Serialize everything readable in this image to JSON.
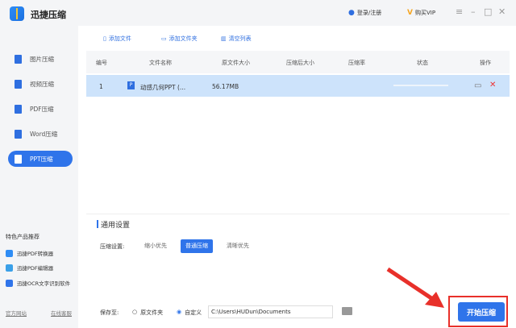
{
  "app": {
    "title": "迅捷压缩",
    "login": "登录/注册",
    "vip": "购买VIP"
  },
  "sidebar": {
    "items": [
      {
        "label": "图片压缩"
      },
      {
        "label": "视频压缩"
      },
      {
        "label": "PDF压缩"
      },
      {
        "label": "Word压缩"
      },
      {
        "label": "PPT压缩"
      }
    ],
    "promo_title": "特色产品推荐",
    "promos": [
      "迅捷PDF转换器",
      "迅捷PDF编辑器",
      "迅捷OCR文字识别软件"
    ],
    "links": [
      "官方网站",
      "在线客服"
    ]
  },
  "toolbar": {
    "add_file": "添加文件",
    "add_folder": "添加文件夹",
    "clear": "清空列表"
  },
  "table": {
    "headers": [
      "编号",
      "文件名称",
      "原文件大小",
      "压缩后大小",
      "压缩率",
      "状态",
      "操作"
    ],
    "rows": [
      {
        "no": "1",
        "name": "动感几何PPT (...",
        "size": "56.17MB",
        "progress": 0
      }
    ]
  },
  "settings": {
    "title": "通用设置",
    "label": "压缩设置:",
    "options": [
      "缩小优先",
      "普通压缩",
      "清晰优先"
    ],
    "selected": "普通压缩"
  },
  "save": {
    "label": "保存至:",
    "opt1": "原文件夹",
    "opt2": "自定义",
    "path": "C:\\Users\\HUDun\\Documents"
  },
  "start_label": "开始压缩"
}
